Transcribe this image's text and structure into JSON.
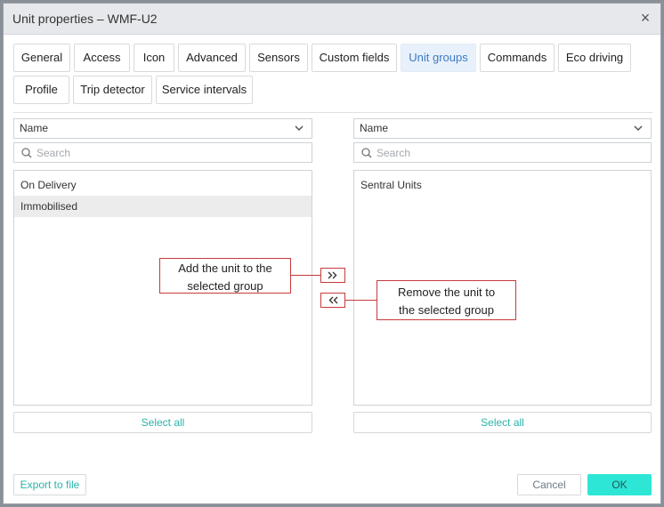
{
  "window": {
    "title": "Unit properties – WMF-U2"
  },
  "tabs": [
    {
      "label": "General",
      "active": false
    },
    {
      "label": "Access",
      "active": false
    },
    {
      "label": "Icon",
      "active": false
    },
    {
      "label": "Advanced",
      "active": false
    },
    {
      "label": "Sensors",
      "active": false
    },
    {
      "label": "Custom fields",
      "active": false
    },
    {
      "label": "Unit groups",
      "active": true
    },
    {
      "label": "Commands",
      "active": false
    },
    {
      "label": "Eco driving",
      "active": false
    },
    {
      "label": "Profile",
      "active": false
    },
    {
      "label": "Trip detector",
      "active": false
    },
    {
      "label": "Service intervals",
      "active": false
    }
  ],
  "left_panel": {
    "sort_value": "Name",
    "search_placeholder": "Search",
    "items": [
      "On Delivery",
      "Immobilised"
    ],
    "select_all_label": "Select all"
  },
  "right_panel": {
    "sort_value": "Name",
    "search_placeholder": "Search",
    "items": [
      "Sentral Units"
    ],
    "select_all_label": "Select all"
  },
  "callouts": {
    "add": {
      "line1": "Add the unit to the",
      "line2": "selected group"
    },
    "remove": {
      "line1": "Remove the unit to",
      "line2": "the selected group"
    }
  },
  "footer": {
    "export_label": "Export to file",
    "cancel_label": "Cancel",
    "ok_label": "OK"
  },
  "colors": {
    "accent": "#2ab3a8",
    "ok_button": "#2ee6d6",
    "active_tab_text": "#3c7ac4",
    "callout_border": "#c63b3b"
  }
}
